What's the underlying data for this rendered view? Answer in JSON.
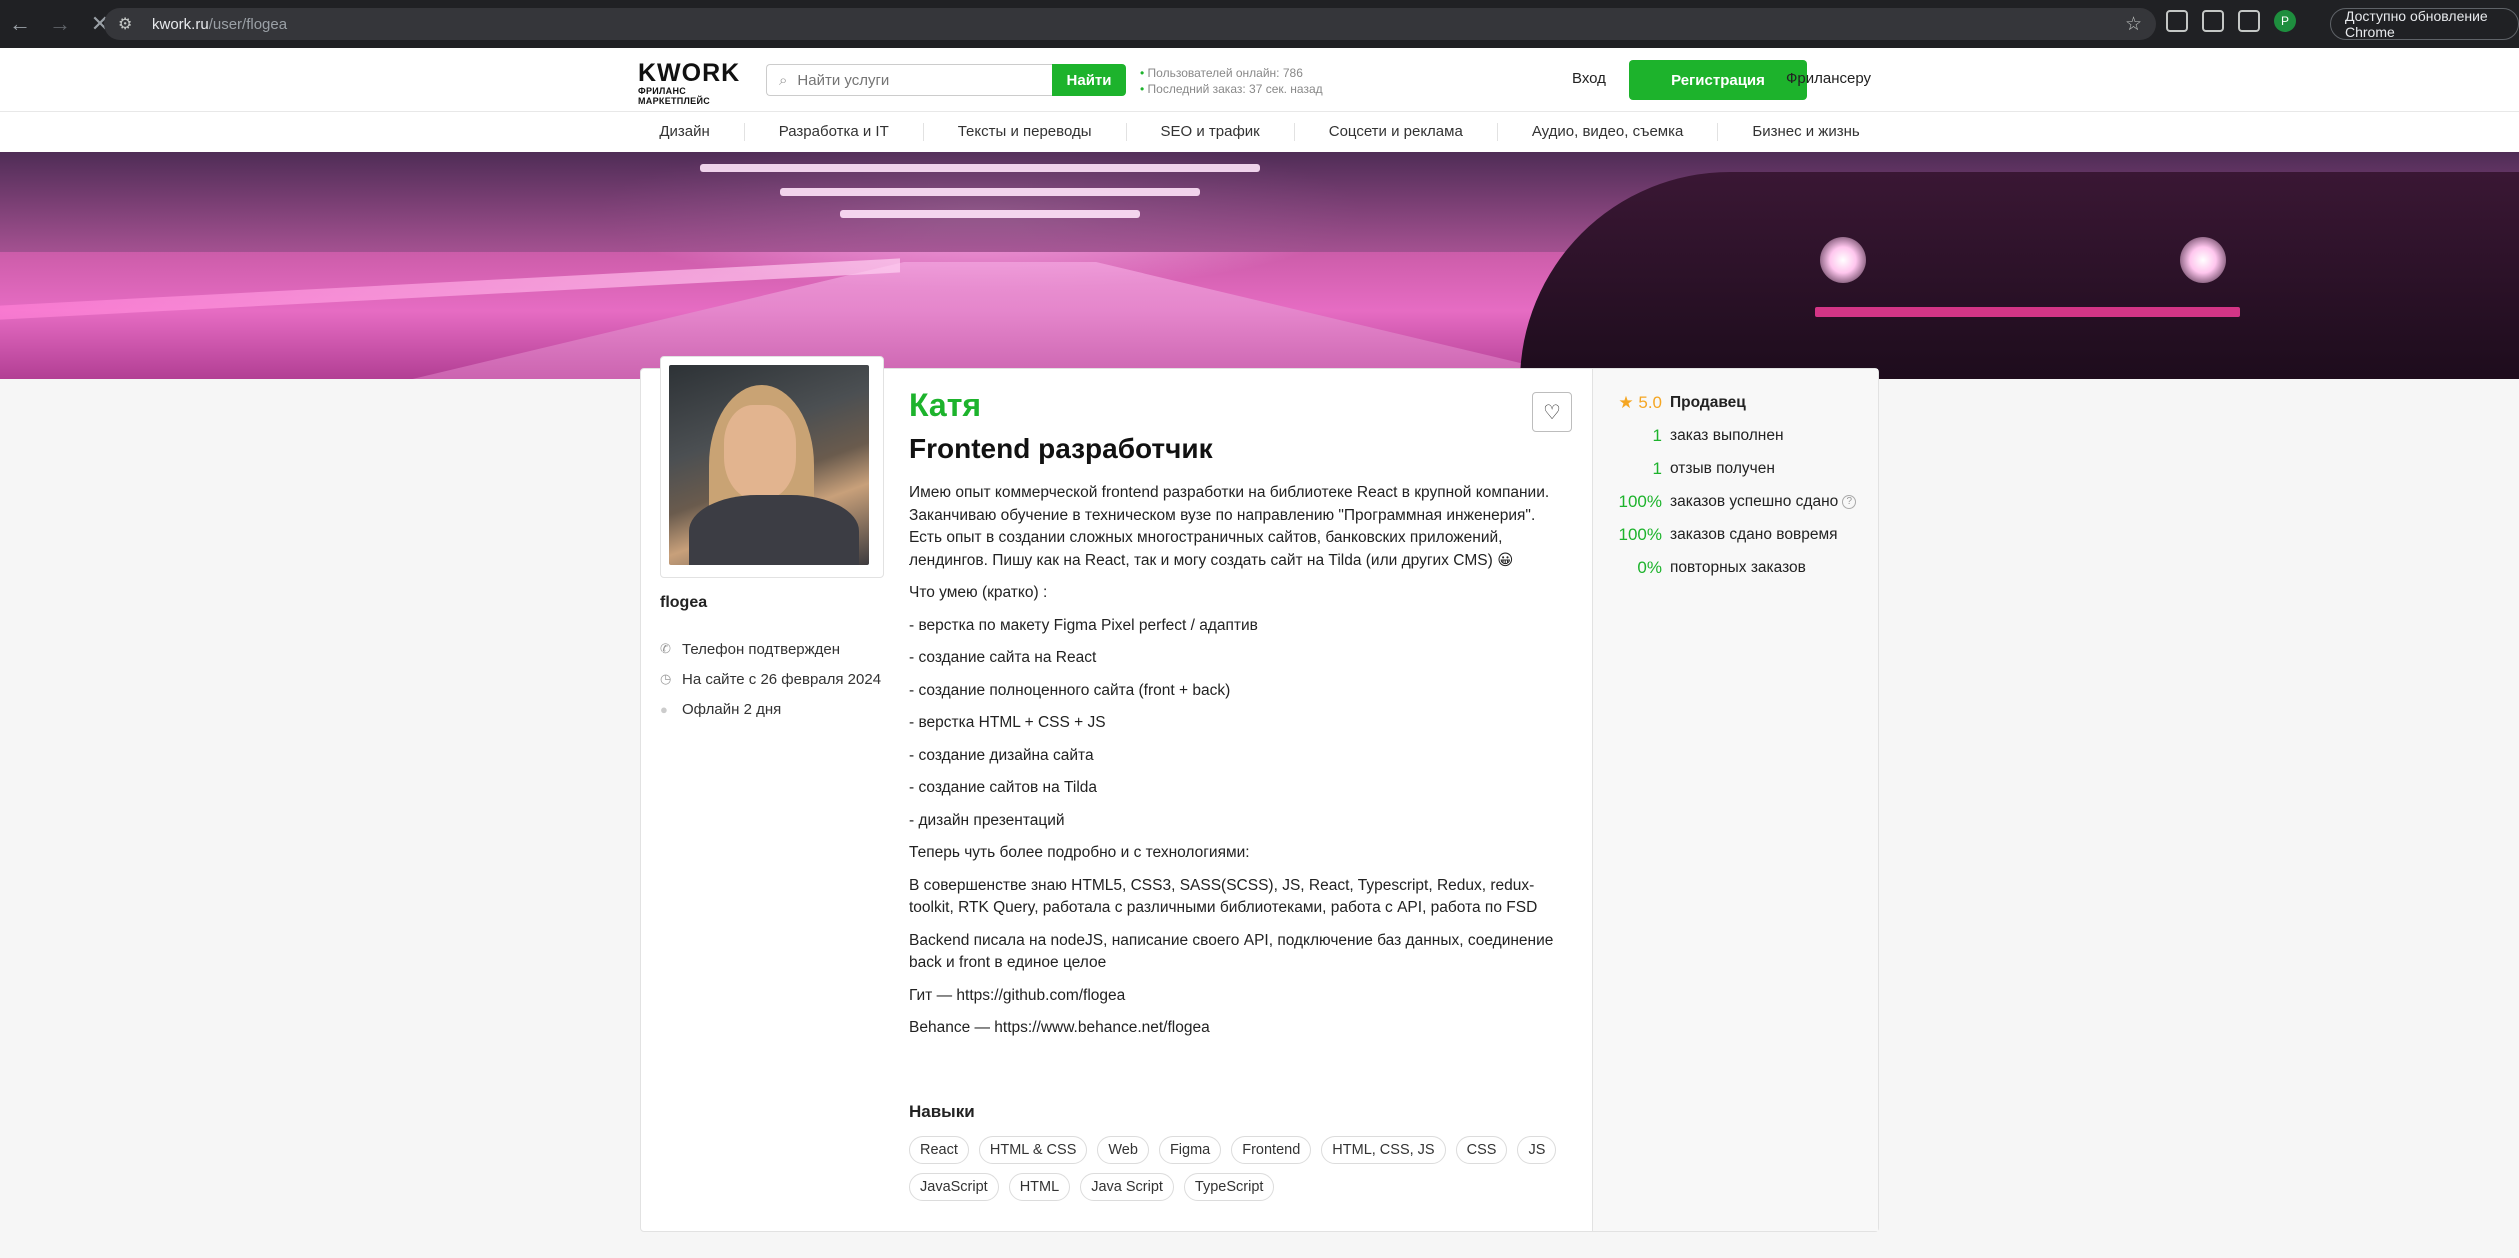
{
  "browser": {
    "url_host": "kwork.ru",
    "url_path": "/user/flogea",
    "update_label": "Доступно обновление Chrome",
    "profile_initial": "P"
  },
  "header": {
    "logo_word": "KWORK",
    "logo_sub": "ФРИЛАНС МАРКЕТПЛЕЙС",
    "search_placeholder": "Найти услуги",
    "search_button": "Найти",
    "stat_online": "Пользователей онлайн: 786",
    "stat_last_order": "Последний заказ: 37 сек. назад",
    "login": "Вход",
    "register": "Регистрация",
    "freelancer": "Фрилансеру"
  },
  "categories": [
    "Дизайн",
    "Разработка и IT",
    "Тексты и переводы",
    "SEO и трафик",
    "Соцсети и реклама",
    "Аудио, видео, съемка",
    "Бизнес и жизнь"
  ],
  "profile": {
    "username": "flogea",
    "meta": {
      "phone": "Телефон подтвержден",
      "since": "На сайте с 26 февраля 2024",
      "status": "Офлайн 2 дня"
    },
    "name": "Катя",
    "title": "Frontend разработчик",
    "description": [
      "Имею опыт коммерческой frontend разработки на библиотеке React в крупной компании. Заканчиваю обучение в техническом вузе по направлению \"Программная инженерия\". Есть опыт в создании сложных многостраничных сайтов, банковских приложений, лендингов. Пишу как на React, так и могу создать сайт на Tilda (или других CMS) 😀",
      "Что умею (кратко) :",
      "- верстка по макету Figma Pixel perfect / адаптив",
      "- создание сайта на React",
      "- создание полноценного сайта (front + back)",
      "- верстка HTML + CSS + JS",
      "- создание дизайна сайта",
      "- создание сайтов на Tilda",
      "- дизайн презентаций",
      "Теперь чуть более подробно и с технологиями:",
      "В совершенстве знаю HTML5, CSS3, SASS(SCSS), JS, React, Typescript, Redux, redux-toolkit, RTK Query, работала с различными библиотеками, работа с API, работа по FSD",
      "Backend писала на nodeJS, написание своего API, подключение баз данных, соединение back и front в единое целое",
      "Гит — https://github.com/flogea",
      "Behance — https://www.behance.net/flogea"
    ],
    "skills_heading": "Навыки",
    "skills": [
      "React",
      "HTML & CSS",
      "Web",
      "Figma",
      "Frontend",
      "HTML, CSS, JS",
      "CSS",
      "JS",
      "JavaScript",
      "HTML",
      "Java Script",
      "TypeScript"
    ]
  },
  "stats": {
    "rating": "5.0",
    "role": "Продавец",
    "rows": [
      {
        "num": "1",
        "label": "заказ выполнен"
      },
      {
        "num": "1",
        "label": "отзыв получен"
      },
      {
        "num": "100%",
        "label": "заказов успешно сдано",
        "help": "?"
      },
      {
        "num": "100%",
        "label": "заказов сдано вовремя"
      },
      {
        "num": "0%",
        "label": "повторных заказов"
      }
    ]
  },
  "colors": {
    "accent": "#1db32c",
    "star": "#f5a623"
  }
}
